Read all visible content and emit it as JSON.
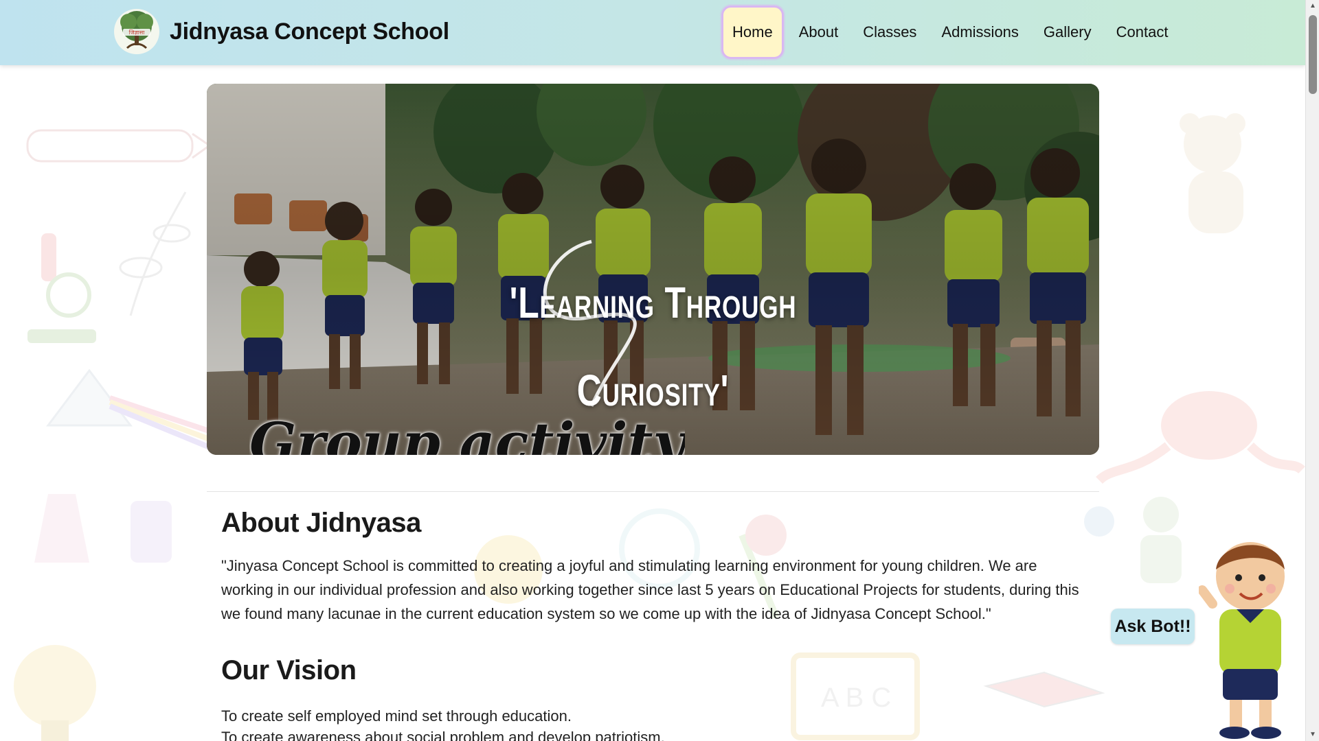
{
  "brand": {
    "name": "Jidnyasa Concept School",
    "logo_text": "जिज्ञासा"
  },
  "nav": {
    "items": [
      {
        "label": "Home",
        "active": true
      },
      {
        "label": "About",
        "active": false
      },
      {
        "label": "Classes",
        "active": false
      },
      {
        "label": "Admissions",
        "active": false
      },
      {
        "label": "Gallery",
        "active": false
      },
      {
        "label": "Contact",
        "active": false
      }
    ]
  },
  "hero": {
    "title_line1": "'Learning Through",
    "title_line2": "Curiosity'",
    "caption": "Group activity"
  },
  "about": {
    "heading": "About Jidnyasa",
    "text": "\"Jinyasa Concept School is committed to creating a joyful and stimulating learning environment for young children. We are working in our individual profession and also working together since last 5 years on Educational Projects for students, during this we found many lacunae in the current education system so we come up with the idea of Jidnyasa Concept School.\""
  },
  "vision": {
    "heading": "Our Vision",
    "items": [
      "To create self employed mind set through education.",
      "To create awareness about social problem and develop patriotism."
    ]
  },
  "askbot": {
    "label": "Ask Bot!!"
  },
  "colors": {
    "header_gradient_start": "#bfe3ef",
    "header_gradient_end": "#c8ebd6",
    "active_tab_bg": "#fff6c8",
    "active_tab_border": "#d9b7f2",
    "uniform_green": "#b5d334",
    "uniform_navy": "#1e2a5a",
    "askbot_bg": "#c7e8f0"
  },
  "icons": [
    "tree-logo-icon",
    "scroll-up-icon",
    "scroll-down-icon",
    "chatbot-mascot-icon"
  ]
}
